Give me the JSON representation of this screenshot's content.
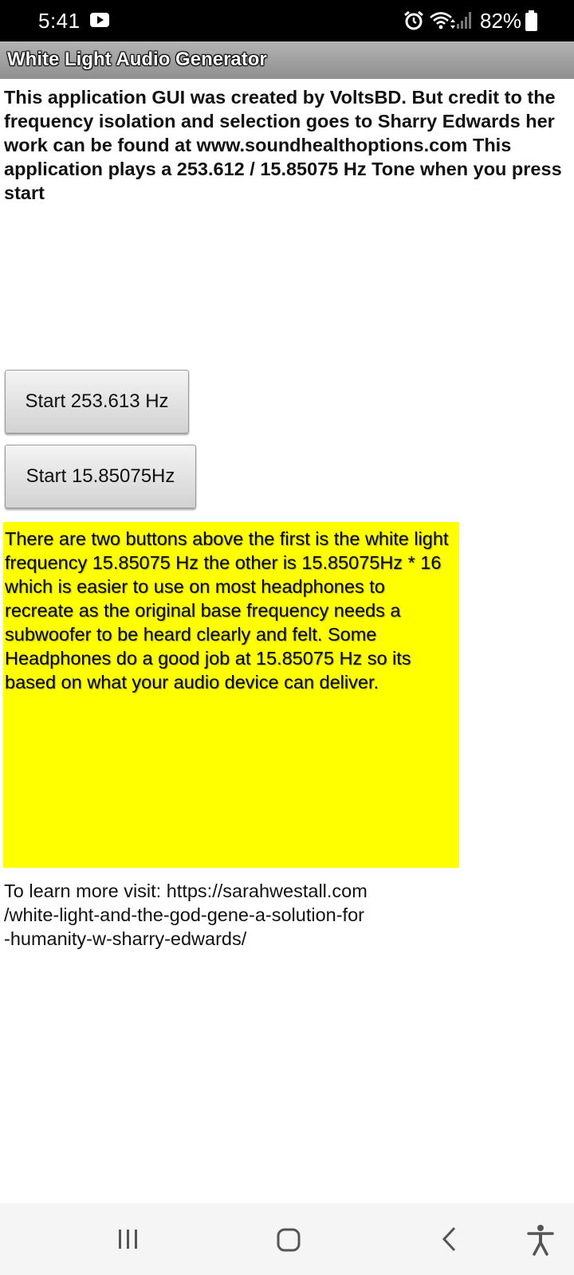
{
  "status_bar": {
    "time": "5:41",
    "battery": "82%",
    "icons": [
      "youtube-icon",
      "alarm-icon",
      "wifi-icon",
      "signal-icon",
      "battery-icon"
    ]
  },
  "app": {
    "title": "White Light Audio Generator",
    "title_bar_color": "#9e9e9e"
  },
  "intro": {
    "text": "This application GUI was created by VoltsBD. But credit to the frequency isolation and selection goes to Sharry Edwards her work can be found at www.soundhealthoptions.com This application plays a 253.612 / 15.85075 Hz Tone when you press start"
  },
  "buttons": {
    "start_high": "Start 253.613 Hz",
    "start_low": "Start 15.85075Hz"
  },
  "info": {
    "text": "There are two buttons above the first is the white light frequency 15.85075 Hz the other is 15.85075Hz * 16 which is easier to use on most headphones to recreate as the original base frequency needs a subwoofer to be heard clearly and felt. Some Headphones do a good job at 15.85075 Hz so its based on what your audio device can deliver.",
    "background_color": "#ffff00"
  },
  "learn_more": {
    "text": "To learn more visit: https://sarahwestall.com\n/white-light-and-the-god-gene-a-solution-for\n-humanity-w-sharry-edwards/"
  },
  "nav_bar": {
    "icons": [
      "recent-apps-icon",
      "home-icon",
      "back-icon",
      "accessibility-icon"
    ]
  }
}
